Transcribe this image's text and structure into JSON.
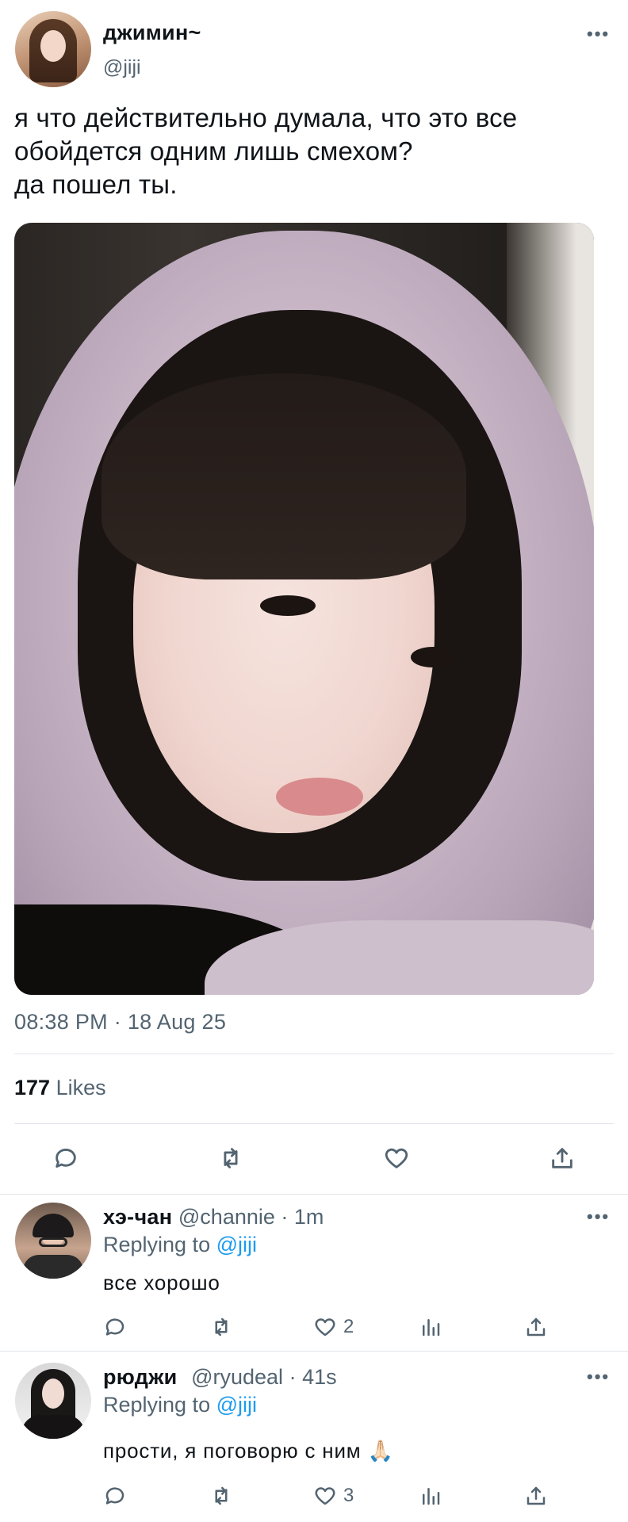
{
  "tweet": {
    "author_name": "джимин~",
    "author_handle": "@jiji",
    "more_label": "•••",
    "text_lines": [
      "я что действительно думала, что это все",
      "обойдется одним лишь смехом?",
      "да пошел ты."
    ],
    "timestamp": "08:38 PM · 18 Aug 25",
    "likes_count": "177",
    "likes_label": "Likes",
    "actions": [
      "reply-icon",
      "retweet-icon",
      "like-icon",
      "share-icon"
    ]
  },
  "replies": [
    {
      "name": "хэ-чан",
      "handle": "@channie",
      "time": "· 1m",
      "replying_prefix": "Replying to",
      "replying_to": "@jiji",
      "text": "все хорошо",
      "like_count": "2",
      "more_label": "•••"
    },
    {
      "name": "рюджи",
      "handle": "@ryudeal",
      "time": "· 41s",
      "replying_prefix": "Replying to",
      "replying_to": "@jiji",
      "text": "прости, я поговорю с ним 🙏🏻",
      "like_count": "3",
      "more_label": "•••"
    }
  ],
  "colors": {
    "text": "#0f1419",
    "secondary": "#536471",
    "accent": "#1d9bf0",
    "divider": "#e1e6ea"
  }
}
